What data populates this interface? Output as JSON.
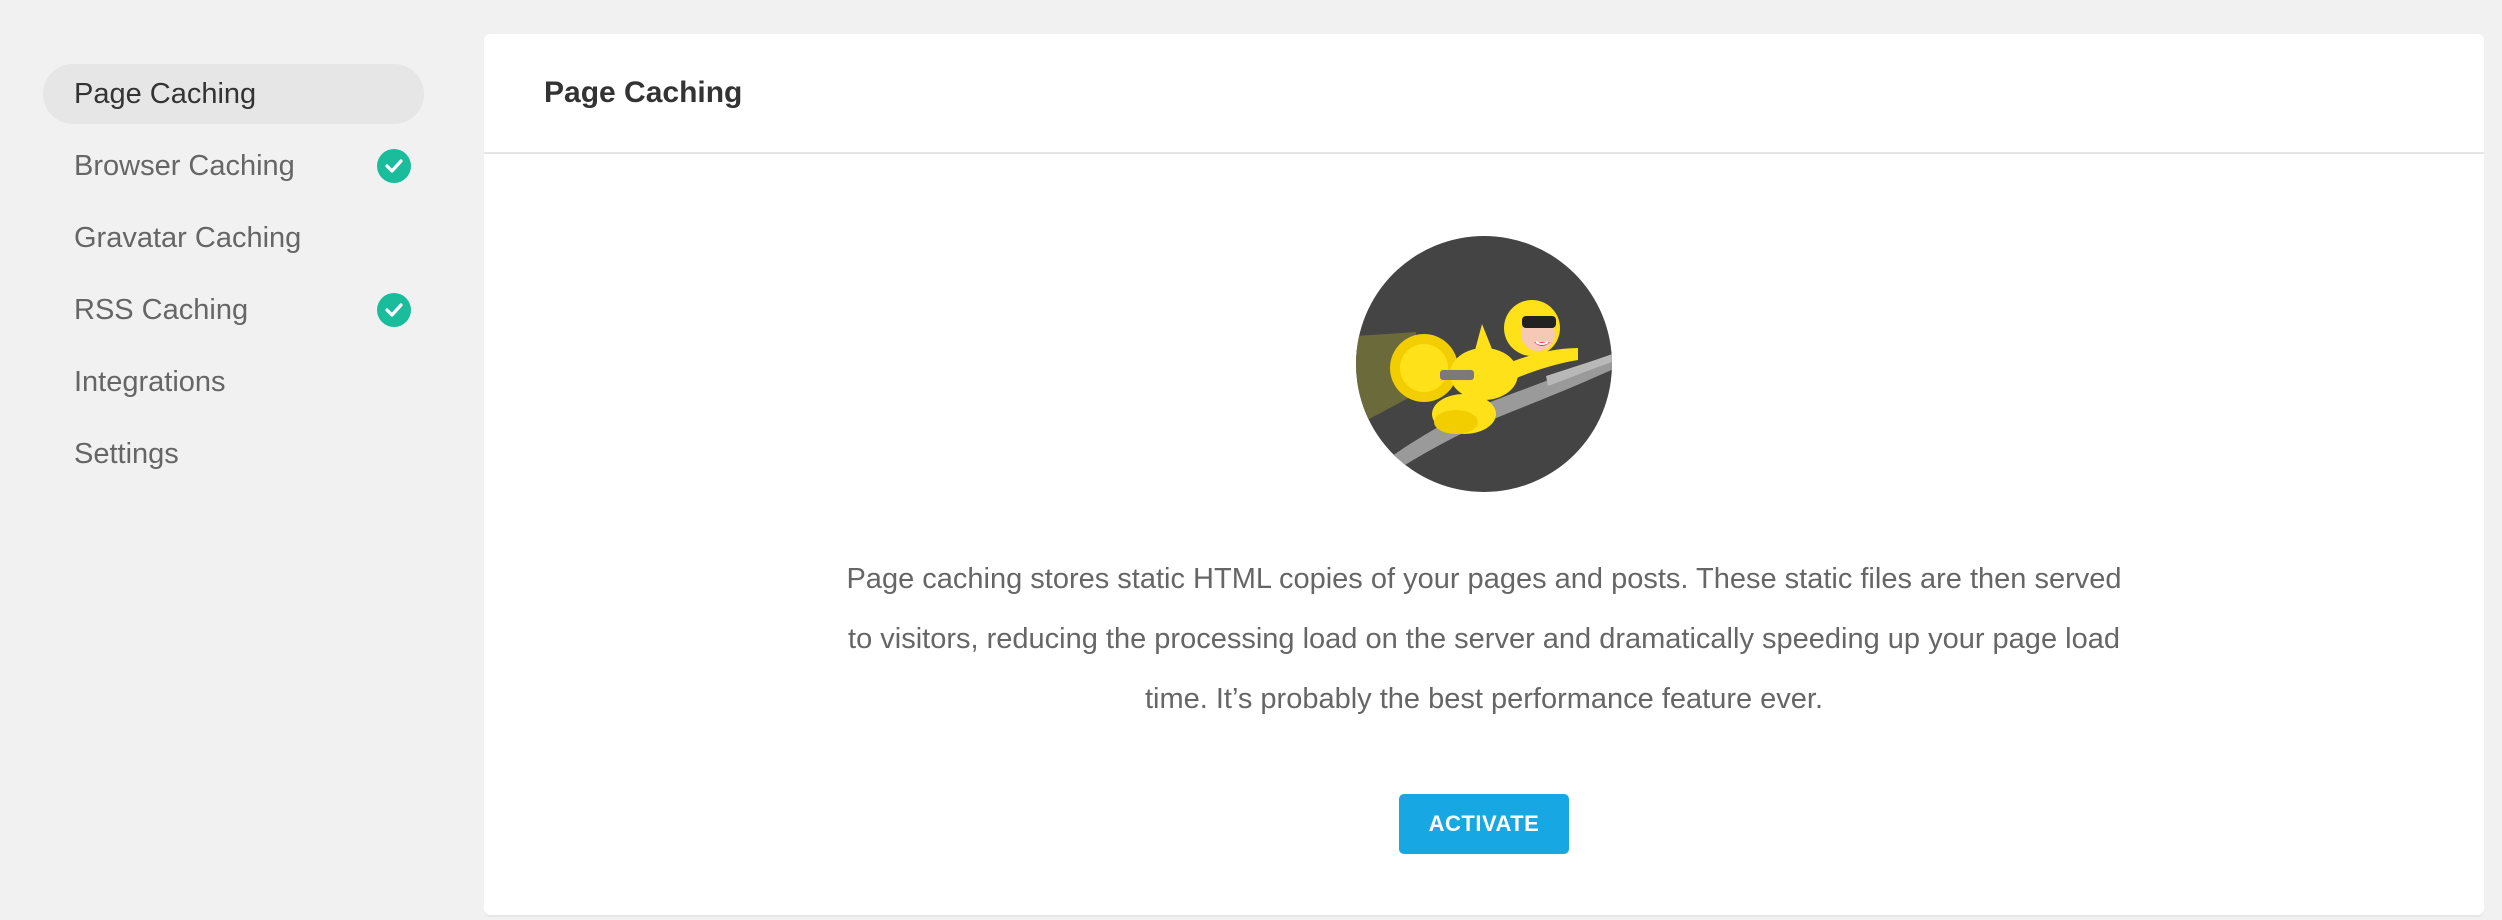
{
  "sidebar": {
    "items": [
      {
        "label": "Page Caching",
        "active": true,
        "checked": false
      },
      {
        "label": "Browser Caching",
        "active": false,
        "checked": true
      },
      {
        "label": "Gravatar Caching",
        "active": false,
        "checked": false
      },
      {
        "label": "RSS Caching",
        "active": false,
        "checked": true
      },
      {
        "label": "Integrations",
        "active": false,
        "checked": false
      },
      {
        "label": "Settings",
        "active": false,
        "checked": false
      }
    ]
  },
  "panel": {
    "title": "Page Caching",
    "description": "Page caching stores static HTML copies of your pages and posts. These static files are then served to visitors, reducing the processing load on the server and dramatically speeding up your page load time. It’s probably the best performance feature ever.",
    "activate_label": "ACTIVATE"
  },
  "icons": {
    "check": "check-circle-icon",
    "hero": "rocket-superhero-illustration"
  },
  "colors": {
    "accent_blue": "#17a8e3",
    "check_green": "#1abc9c",
    "hero_bg": "#444444",
    "hero_yellow": "#ffe11a"
  }
}
